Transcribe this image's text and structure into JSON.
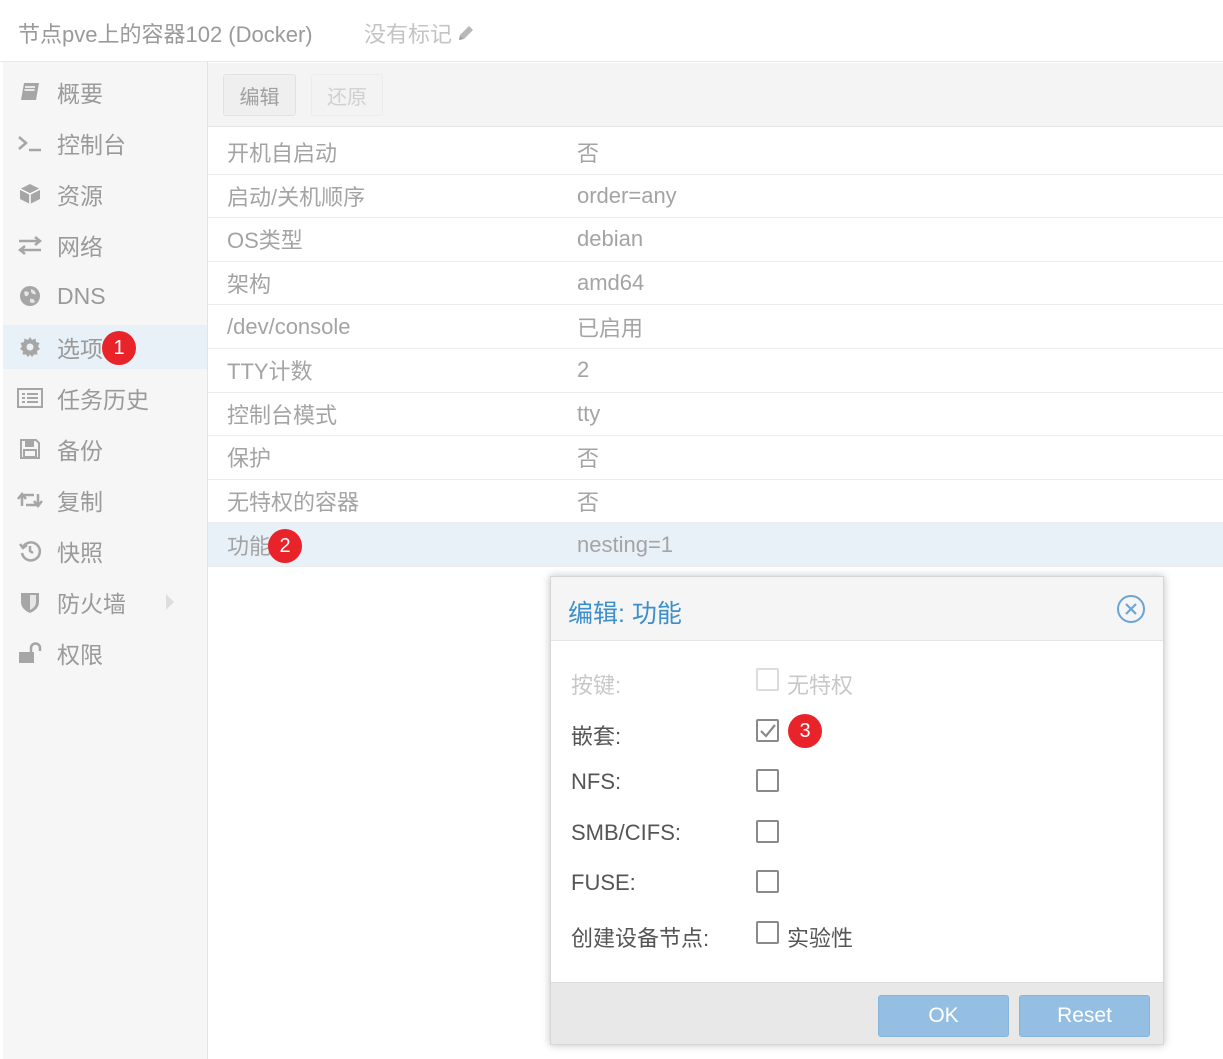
{
  "header": {
    "title": "节点pve上的容器102 (Docker)",
    "tags_label": "没有标记"
  },
  "sidebar": {
    "items": [
      {
        "label": "概要",
        "icon": "book-icon"
      },
      {
        "label": "控制台",
        "icon": "terminal-icon"
      },
      {
        "label": "资源",
        "icon": "cube-icon"
      },
      {
        "label": "网络",
        "icon": "exchange-icon"
      },
      {
        "label": "DNS",
        "icon": "globe-icon"
      },
      {
        "label": "选项",
        "icon": "gear-icon"
      },
      {
        "label": "任务历史",
        "icon": "list-icon"
      },
      {
        "label": "备份",
        "icon": "floppy-icon"
      },
      {
        "label": "复制",
        "icon": "retweet-icon"
      },
      {
        "label": "快照",
        "icon": "history-icon"
      },
      {
        "label": "防火墙",
        "icon": "shield-icon"
      },
      {
        "label": "权限",
        "icon": "unlock-icon"
      }
    ],
    "active_index": 5
  },
  "toolbar": {
    "edit_label": "编辑",
    "revert_label": "还原"
  },
  "options": {
    "rows": [
      {
        "key": "开机自启动",
        "value": "否"
      },
      {
        "key": "启动/关机顺序",
        "value": "order=any"
      },
      {
        "key": "OS类型",
        "value": "debian"
      },
      {
        "key": "架构",
        "value": "amd64"
      },
      {
        "key": "/dev/console",
        "value": "已启用"
      },
      {
        "key": "TTY计数",
        "value": "2"
      },
      {
        "key": "控制台模式",
        "value": "tty"
      },
      {
        "key": "保护",
        "value": "否"
      },
      {
        "key": "无特权的容器",
        "value": "否"
      },
      {
        "key": "功能",
        "value": "nesting=1"
      }
    ],
    "selected_index": 9
  },
  "dialog": {
    "title": "编辑: 功能",
    "fields": [
      {
        "label": "按键:",
        "checked": false,
        "disabled": true,
        "box_label": "无特权"
      },
      {
        "label": "嵌套:",
        "checked": true,
        "disabled": false,
        "box_label": ""
      },
      {
        "label": "NFS:",
        "checked": false,
        "disabled": false,
        "box_label": ""
      },
      {
        "label": "SMB/CIFS:",
        "checked": false,
        "disabled": false,
        "box_label": ""
      },
      {
        "label": "FUSE:",
        "checked": false,
        "disabled": false,
        "box_label": ""
      },
      {
        "label": "创建设备节点:",
        "checked": false,
        "disabled": false,
        "box_label": "实验性"
      }
    ],
    "ok_label": "OK",
    "reset_label": "Reset"
  },
  "annotations": {
    "badge1": "1",
    "badge2": "2",
    "badge3": "3"
  },
  "colors": {
    "accent": "#3c8fcb",
    "badge": "#e8232a",
    "selection": "#e9f1f8",
    "primary_button": "#94bfe2"
  }
}
